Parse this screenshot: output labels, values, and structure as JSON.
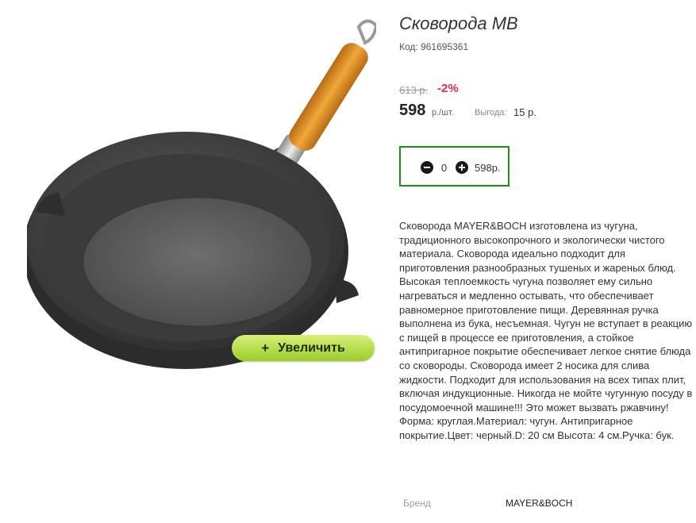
{
  "product": {
    "title": "Сковорода MB",
    "sku": "Код: 961695361",
    "old_price": "613 р.",
    "discount": "-2%",
    "price": "598",
    "price_unit": "р./шт.",
    "savings_label": "Выгода:",
    "savings_value": "15 р."
  },
  "cart": {
    "quantity": "0",
    "total": "598р."
  },
  "gallery": {
    "zoom_plus": "+",
    "zoom_label": "Увеличить"
  },
  "description": "Сковорода MAYER&BOCH изготовлена из чугуна, традиционного высокопрочного и экологически чистого материала. Сковорода идеально подходит для приготовления разнообразных тушеных и жареных блюд. Высокая теплоемкость чугуна позволяет ему сильно нагреваться и медленно остывать, что обеспечивает равномерное приготовление пищи. Деревянная ручка выполнена из бука, несъемная. Чугун не вступает в реакцию с пищей в процессе ее приготовления, а стойкое антипригарное покрытие обеспечивает легкое снятие блюда со сковороды. Сковорода имеет 2 носика для слива жидкости. Подходит для использования на всех типах плит, включая индукционные. Никогда не мойте чугунную посуду в посудомоечной машине!!! Это может вызвать ржавчину! Форма: круглая.Материал: чугун. Антипригарное покрытие.Цвет: черный.D: 20 см Высота: 4 см.Ручка: бук.",
  "attributes": {
    "brand_label": "Бренд",
    "brand_value": "MAYER&BOCH"
  },
  "colors": {
    "discount": "#e0284f",
    "qty_border": "#1f8c1f",
    "zoom_button": "#9ccc2a"
  },
  "icons": {
    "decrease": "minus-circle-icon",
    "increase": "plus-circle-icon"
  }
}
